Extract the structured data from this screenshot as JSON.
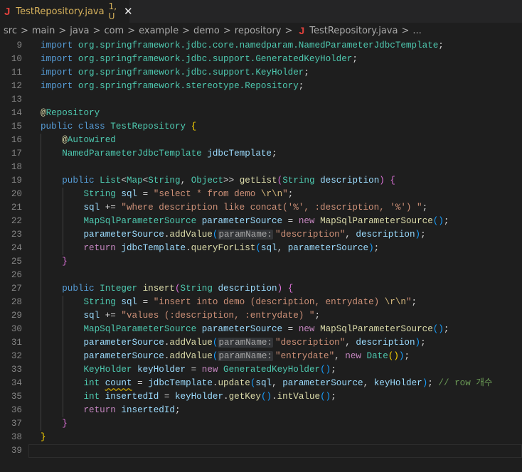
{
  "tab": {
    "icon": "java-icon",
    "title": "TestRepository.java",
    "status": "1, U",
    "close": "✕"
  },
  "breadcrumb": {
    "items": [
      "src",
      "main",
      "java",
      "com",
      "example",
      "demo",
      "repository"
    ],
    "file": "TestRepository.java",
    "more": "...",
    "separator": ">"
  },
  "lines": [
    {
      "n": "9",
      "t": [
        [
          "import",
          "kw"
        ],
        [
          " ",
          "pl"
        ],
        [
          "org.springframework.jdbc.core.namedparam.NamedParameterJdbcTemplate",
          "ty"
        ],
        [
          ";",
          "pl"
        ]
      ]
    },
    {
      "n": "10",
      "t": [
        [
          "import",
          "kw"
        ],
        [
          " ",
          "pl"
        ],
        [
          "org.springframework.jdbc.support.GeneratedKeyHolder",
          "ty"
        ],
        [
          ";",
          "pl"
        ]
      ]
    },
    {
      "n": "11",
      "t": [
        [
          "import",
          "kw"
        ],
        [
          " ",
          "pl"
        ],
        [
          "org.springframework.jdbc.support.KeyHolder",
          "ty"
        ],
        [
          ";",
          "pl"
        ]
      ]
    },
    {
      "n": "12",
      "t": [
        [
          "import",
          "kw"
        ],
        [
          " ",
          "pl"
        ],
        [
          "org.springframework.stereotype.Repository",
          "ty"
        ],
        [
          ";",
          "pl"
        ]
      ]
    },
    {
      "n": "13",
      "t": []
    },
    {
      "n": "14",
      "t": [
        [
          "@",
          "at"
        ],
        [
          "Repository",
          "ty"
        ]
      ]
    },
    {
      "n": "15",
      "t": [
        [
          "public class",
          "kw"
        ],
        [
          " ",
          "pl"
        ],
        [
          "TestRepository",
          "ty"
        ],
        [
          " ",
          "pl"
        ],
        [
          "{",
          "b1"
        ]
      ]
    },
    {
      "n": "16",
      "t": [
        [
          "    ",
          "pl"
        ],
        [
          "@",
          "at"
        ],
        [
          "Autowired",
          "ty"
        ]
      ]
    },
    {
      "n": "17",
      "t": [
        [
          "    ",
          "pl"
        ],
        [
          "NamedParameterJdbcTemplate",
          "ty"
        ],
        [
          " ",
          "pl"
        ],
        [
          "jdbcTemplate",
          "var"
        ],
        [
          ";",
          "pl"
        ]
      ]
    },
    {
      "n": "18",
      "t": []
    },
    {
      "n": "19",
      "t": [
        [
          "    ",
          "pl"
        ],
        [
          "public",
          "kw"
        ],
        [
          " ",
          "pl"
        ],
        [
          "List",
          "ty"
        ],
        [
          "<",
          "pl"
        ],
        [
          "Map",
          "ty"
        ],
        [
          "<",
          "pl"
        ],
        [
          "String",
          "ty"
        ],
        [
          ", ",
          "pl"
        ],
        [
          "Object",
          "ty"
        ],
        [
          ">> ",
          "pl"
        ],
        [
          "getList",
          "fn"
        ],
        [
          "(",
          "b2"
        ],
        [
          "String",
          "ty"
        ],
        [
          " ",
          "pl"
        ],
        [
          "description",
          "var"
        ],
        [
          ")",
          "b2"
        ],
        [
          " ",
          "pl"
        ],
        [
          "{",
          "b2"
        ]
      ]
    },
    {
      "n": "20",
      "t": [
        [
          "        ",
          "pl"
        ],
        [
          "String",
          "ty"
        ],
        [
          " ",
          "pl"
        ],
        [
          "sql",
          "var"
        ],
        [
          " = ",
          "pl"
        ],
        [
          "\"select * from demo ",
          "str"
        ],
        [
          "\\r\\n",
          "esc"
        ],
        [
          "\"",
          "str"
        ],
        [
          ";",
          "pl"
        ]
      ]
    },
    {
      "n": "21",
      "t": [
        [
          "        ",
          "pl"
        ],
        [
          "sql",
          "var"
        ],
        [
          " += ",
          "pl"
        ],
        [
          "\"where description like concat('%', :description, '%') \"",
          "str"
        ],
        [
          ";",
          "pl"
        ]
      ]
    },
    {
      "n": "22",
      "t": [
        [
          "        ",
          "pl"
        ],
        [
          "MapSqlParameterSource",
          "ty"
        ],
        [
          " ",
          "pl"
        ],
        [
          "parameterSource",
          "var"
        ],
        [
          " = ",
          "pl"
        ],
        [
          "new",
          "ctl"
        ],
        [
          " ",
          "pl"
        ],
        [
          "MapSqlParameterSource",
          "fn"
        ],
        [
          "()",
          "b3"
        ],
        [
          ";",
          "pl"
        ]
      ]
    },
    {
      "n": "23",
      "t": [
        [
          "        ",
          "pl"
        ],
        [
          "parameterSource",
          "var"
        ],
        [
          ".",
          "pl"
        ],
        [
          "addValue",
          "fn"
        ],
        [
          "(",
          "b3"
        ],
        [
          "paramName:",
          "hint"
        ],
        [
          "\"description\"",
          "str"
        ],
        [
          ", ",
          "pl"
        ],
        [
          "description",
          "var"
        ],
        [
          ")",
          "b3"
        ],
        [
          ";",
          "pl"
        ]
      ]
    },
    {
      "n": "24",
      "t": [
        [
          "        ",
          "pl"
        ],
        [
          "return",
          "ctl"
        ],
        [
          " ",
          "pl"
        ],
        [
          "jdbcTemplate",
          "var"
        ],
        [
          ".",
          "pl"
        ],
        [
          "queryForList",
          "fn"
        ],
        [
          "(",
          "b3"
        ],
        [
          "sql",
          "var"
        ],
        [
          ", ",
          "pl"
        ],
        [
          "parameterSource",
          "var"
        ],
        [
          ")",
          "b3"
        ],
        [
          ";",
          "pl"
        ]
      ]
    },
    {
      "n": "25",
      "t": [
        [
          "    ",
          "pl"
        ],
        [
          "}",
          "b2"
        ]
      ]
    },
    {
      "n": "26",
      "t": []
    },
    {
      "n": "27",
      "t": [
        [
          "    ",
          "pl"
        ],
        [
          "public",
          "kw"
        ],
        [
          " ",
          "pl"
        ],
        [
          "Integer",
          "ty"
        ],
        [
          " ",
          "pl"
        ],
        [
          "insert",
          "fn"
        ],
        [
          "(",
          "b2"
        ],
        [
          "String",
          "ty"
        ],
        [
          " ",
          "pl"
        ],
        [
          "description",
          "var"
        ],
        [
          ")",
          "b2"
        ],
        [
          " ",
          "pl"
        ],
        [
          "{",
          "b2"
        ]
      ]
    },
    {
      "n": "28",
      "t": [
        [
          "        ",
          "pl"
        ],
        [
          "String",
          "ty"
        ],
        [
          " ",
          "pl"
        ],
        [
          "sql",
          "var"
        ],
        [
          " = ",
          "pl"
        ],
        [
          "\"insert into demo (description, entrydate) ",
          "str"
        ],
        [
          "\\r\\n",
          "esc"
        ],
        [
          "\"",
          "str"
        ],
        [
          ";",
          "pl"
        ]
      ]
    },
    {
      "n": "29",
      "t": [
        [
          "        ",
          "pl"
        ],
        [
          "sql",
          "var"
        ],
        [
          " += ",
          "pl"
        ],
        [
          "\"values (:description, :entrydate) \"",
          "str"
        ],
        [
          ";",
          "pl"
        ]
      ]
    },
    {
      "n": "30",
      "t": [
        [
          "        ",
          "pl"
        ],
        [
          "MapSqlParameterSource",
          "ty"
        ],
        [
          " ",
          "pl"
        ],
        [
          "parameterSource",
          "var"
        ],
        [
          " = ",
          "pl"
        ],
        [
          "new",
          "ctl"
        ],
        [
          " ",
          "pl"
        ],
        [
          "MapSqlParameterSource",
          "fn"
        ],
        [
          "()",
          "b3"
        ],
        [
          ";",
          "pl"
        ]
      ]
    },
    {
      "n": "31",
      "t": [
        [
          "        ",
          "pl"
        ],
        [
          "parameterSource",
          "var"
        ],
        [
          ".",
          "pl"
        ],
        [
          "addValue",
          "fn"
        ],
        [
          "(",
          "b3"
        ],
        [
          "paramName:",
          "hint"
        ],
        [
          "\"description\"",
          "str"
        ],
        [
          ", ",
          "pl"
        ],
        [
          "description",
          "var"
        ],
        [
          ")",
          "b3"
        ],
        [
          ";",
          "pl"
        ]
      ]
    },
    {
      "n": "32",
      "t": [
        [
          "        ",
          "pl"
        ],
        [
          "parameterSource",
          "var"
        ],
        [
          ".",
          "pl"
        ],
        [
          "addValue",
          "fn"
        ],
        [
          "(",
          "b3"
        ],
        [
          "paramName:",
          "hint"
        ],
        [
          "\"entrydate\"",
          "str"
        ],
        [
          ", ",
          "pl"
        ],
        [
          "new",
          "ctl"
        ],
        [
          " ",
          "pl"
        ],
        [
          "Date",
          "ty"
        ],
        [
          "()",
          "b1"
        ],
        [
          ")",
          "b3"
        ],
        [
          ";",
          "pl"
        ]
      ]
    },
    {
      "n": "33",
      "t": [
        [
          "        ",
          "pl"
        ],
        [
          "KeyHolder",
          "ty"
        ],
        [
          " ",
          "pl"
        ],
        [
          "keyHolder",
          "var"
        ],
        [
          " = ",
          "pl"
        ],
        [
          "new",
          "ctl"
        ],
        [
          " ",
          "pl"
        ],
        [
          "GeneratedKeyHolder",
          "ty"
        ],
        [
          "()",
          "b3"
        ],
        [
          ";",
          "pl"
        ]
      ]
    },
    {
      "n": "34",
      "t": [
        [
          "        ",
          "pl"
        ],
        [
          "int",
          "ty"
        ],
        [
          " ",
          "pl"
        ],
        [
          "count",
          "var warn"
        ],
        [
          " = ",
          "pl"
        ],
        [
          "jdbcTemplate",
          "var"
        ],
        [
          ".",
          "pl"
        ],
        [
          "update",
          "fn"
        ],
        [
          "(",
          "b3"
        ],
        [
          "sql",
          "var"
        ],
        [
          ", ",
          "pl"
        ],
        [
          "parameterSource",
          "var"
        ],
        [
          ", ",
          "pl"
        ],
        [
          "keyHolder",
          "var"
        ],
        [
          ")",
          "b3"
        ],
        [
          "; ",
          "pl"
        ],
        [
          "// row 개수",
          "cm"
        ]
      ]
    },
    {
      "n": "35",
      "t": [
        [
          "        ",
          "pl"
        ],
        [
          "int",
          "ty"
        ],
        [
          " ",
          "pl"
        ],
        [
          "insertedId",
          "var"
        ],
        [
          " = ",
          "pl"
        ],
        [
          "keyHolder",
          "var"
        ],
        [
          ".",
          "pl"
        ],
        [
          "getKey",
          "fn"
        ],
        [
          "()",
          "b3"
        ],
        [
          ".",
          "pl"
        ],
        [
          "intValue",
          "fn"
        ],
        [
          "()",
          "b3"
        ],
        [
          ";",
          "pl"
        ]
      ]
    },
    {
      "n": "36",
      "t": [
        [
          "        ",
          "pl"
        ],
        [
          "return",
          "ctl"
        ],
        [
          " ",
          "pl"
        ],
        [
          "insertedId",
          "var"
        ],
        [
          ";",
          "pl"
        ]
      ]
    },
    {
      "n": "37",
      "t": [
        [
          "    ",
          "pl"
        ],
        [
          "}",
          "b2"
        ]
      ]
    },
    {
      "n": "38",
      "t": [
        [
          "}",
          "b1"
        ]
      ]
    },
    {
      "n": "39",
      "t": []
    }
  ]
}
